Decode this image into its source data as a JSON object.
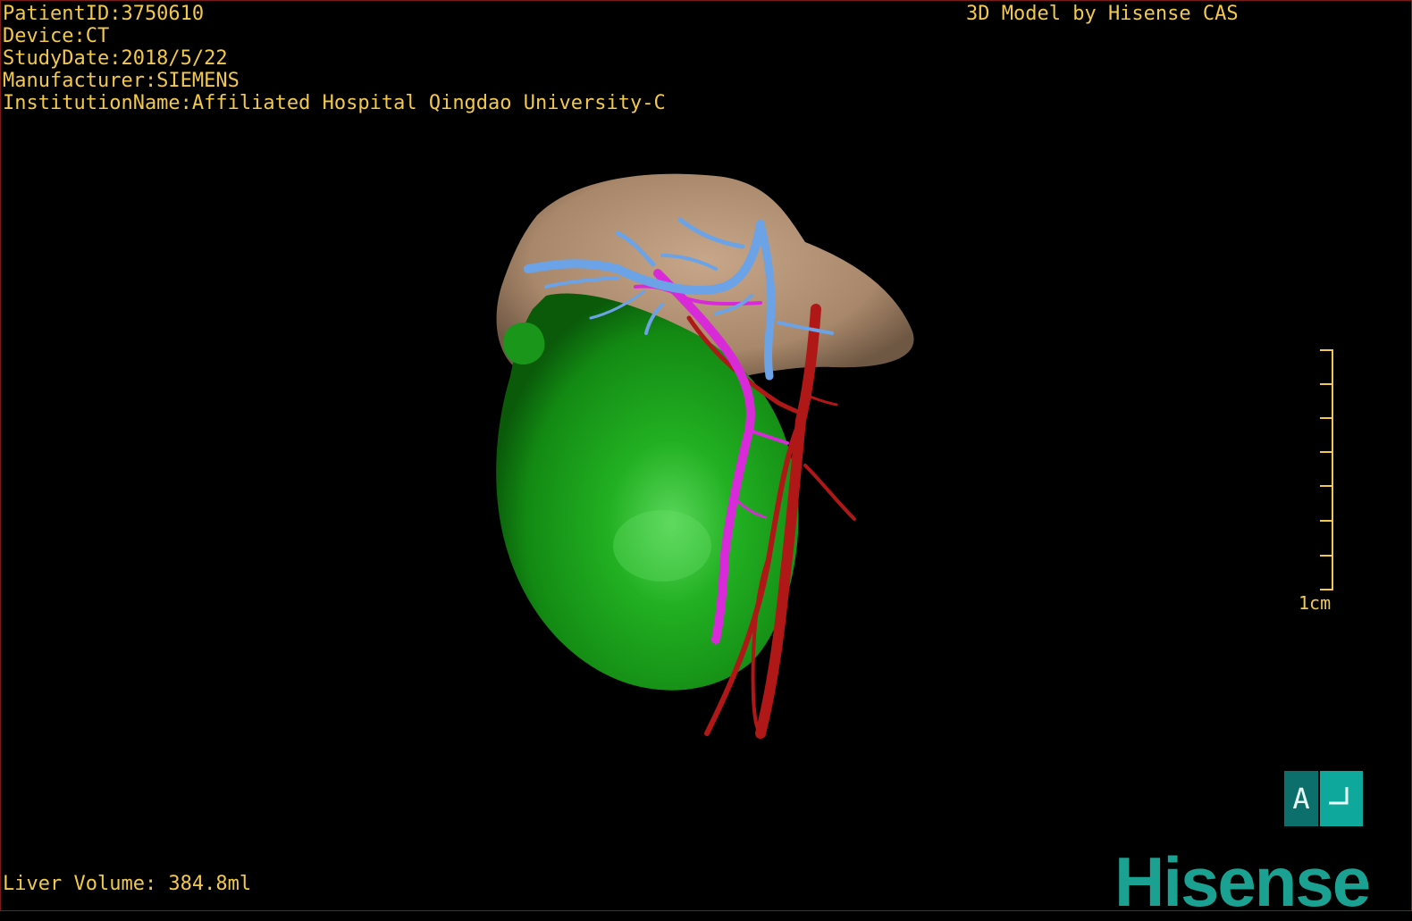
{
  "metadata": {
    "patient_id": "PatientID:3750610",
    "device": "Device:CT",
    "study_date": "StudyDate:2018/5/22",
    "manufacturer": "Manufacturer:SIEMENS",
    "institution": "InstitutionName:Affiliated Hospital Qingdao University-C"
  },
  "credit": "3D Model by Hisense CAS",
  "volume": "Liver Volume: 384.8ml",
  "scale": {
    "label": "1cm"
  },
  "orientation": {
    "label": "A"
  },
  "logo": "Hisense",
  "colors": {
    "liver": "#a8876a",
    "tumor": "#1fa51f",
    "portal_vein": "#6ba3e6",
    "hepatic_artery": "#d92ad9",
    "vena_cava": "#b01818",
    "overlay_text": "#f2c94c",
    "brand": "#1aa191"
  }
}
